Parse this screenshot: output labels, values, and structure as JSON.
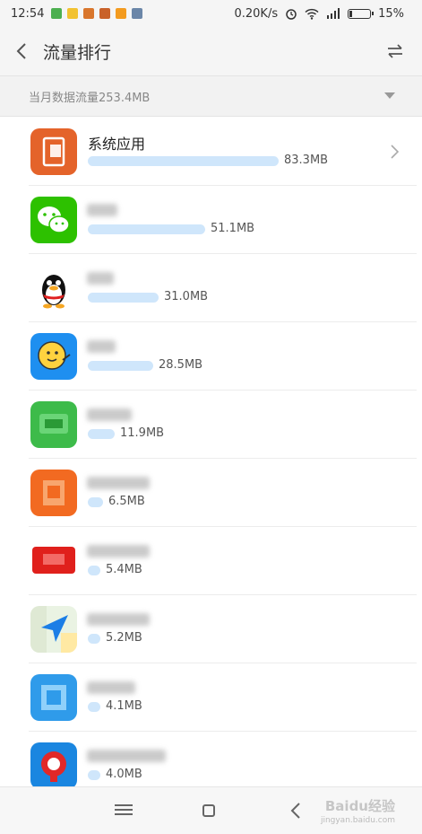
{
  "status_bar": {
    "time": "12:54",
    "net_speed": "0.20K/s",
    "battery_percent": "15%",
    "battery_level": 0.15,
    "notification_icons": [
      "send-icon",
      "app-icon-yellow",
      "game-icon-a",
      "game-icon-b",
      "photo-icon",
      "calendar-icon"
    ],
    "status_icons": [
      "alarm-icon",
      "wifi-icon",
      "signal-icon"
    ]
  },
  "header": {
    "title": "流量排行",
    "back_icon": "chevron-left-icon",
    "sort_icon": "swap-arrows-icon"
  },
  "summary": {
    "text": "当月数据流量253.4MB",
    "dropdown_icon": "caret-down-icon"
  },
  "colors": {
    "usage_bar": "#cfe6fb",
    "system_app": "#e4632a",
    "wechat": "#2dc100",
    "qq_bg": "#ffffff",
    "alipay_blue": "#1e8ff0"
  },
  "apps": [
    {
      "name": "系统应用",
      "usage": "83.3MB",
      "mb": 83.3,
      "icon": "system-apps-icon",
      "blurred_name": false,
      "has_chevron": true
    },
    {
      "name": "",
      "usage": "51.1MB",
      "mb": 51.1,
      "icon": "wechat-icon",
      "blurred_name": true,
      "has_chevron": false
    },
    {
      "name": "",
      "usage": "31.0MB",
      "mb": 31.0,
      "icon": "qq-penguin-icon",
      "blurred_name": true,
      "has_chevron": false
    },
    {
      "name": "",
      "usage": "28.5MB",
      "mb": 28.5,
      "icon": "chick-app-icon",
      "blurred_name": true,
      "has_chevron": false
    },
    {
      "name": "",
      "usage": "11.9MB",
      "mb": 11.9,
      "icon": "green-app-icon",
      "blurred_name": true,
      "has_chevron": false
    },
    {
      "name": "",
      "usage": "6.5MB",
      "mb": 6.5,
      "icon": "orange-app-icon",
      "blurred_name": true,
      "has_chevron": false
    },
    {
      "name": "",
      "usage": "5.4MB",
      "mb": 5.4,
      "icon": "red-app-icon",
      "blurred_name": true,
      "has_chevron": false
    },
    {
      "name": "",
      "usage": "5.2MB",
      "mb": 5.2,
      "icon": "maps-navigation-icon",
      "blurred_name": true,
      "has_chevron": false
    },
    {
      "name": "",
      "usage": "4.1MB",
      "mb": 4.1,
      "icon": "blue-app-icon",
      "blurred_name": true,
      "has_chevron": false
    },
    {
      "name": "",
      "usage": "4.0MB",
      "mb": 4.0,
      "icon": "railway-app-icon",
      "blurred_name": true,
      "has_chevron": false
    }
  ],
  "nav_bar": {
    "menu_icon": "menu-icon",
    "home_icon": "home-icon",
    "back_icon": "back-icon",
    "watermark": "Baidu经验",
    "watermark_sub": "jingyan.baidu.com"
  }
}
